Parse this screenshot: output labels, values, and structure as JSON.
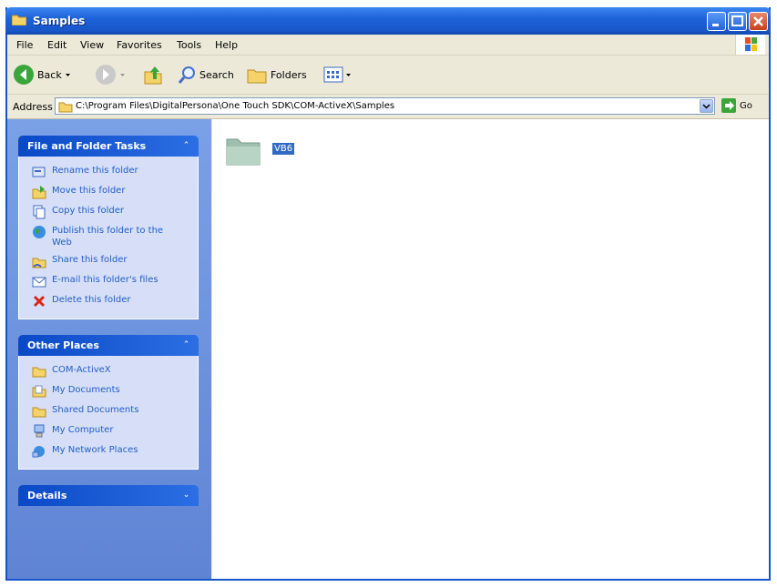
{
  "window": {
    "title": "Samples"
  },
  "menu": {
    "items": [
      "File",
      "Edit",
      "View",
      "Favorites",
      "Tools",
      "Help"
    ]
  },
  "toolbar": {
    "back": "Back",
    "search": "Search",
    "folders": "Folders"
  },
  "address": {
    "label": "Address",
    "path": "C:\\Program Files\\DigitalPersona\\One Touch SDK\\COM-ActiveX\\Samples",
    "go": "Go"
  },
  "file_folder_tasks": {
    "title": "File and Folder Tasks",
    "items": [
      {
        "label": "Rename this folder",
        "icon": "rename-icon"
      },
      {
        "label": "Move this folder",
        "icon": "move-icon"
      },
      {
        "label": "Copy this folder",
        "icon": "copy-icon"
      },
      {
        "label": "Publish this folder to the Web",
        "icon": "globe-icon"
      },
      {
        "label": "Share this folder",
        "icon": "share-icon"
      },
      {
        "label": "E-mail this folder's files",
        "icon": "email-icon"
      },
      {
        "label": "Delete this folder",
        "icon": "delete-icon"
      }
    ]
  },
  "other_places": {
    "title": "Other Places",
    "items": [
      {
        "label": "COM-ActiveX",
        "icon": "folder-icon"
      },
      {
        "label": "My Documents",
        "icon": "documents-icon"
      },
      {
        "label": "Shared Documents",
        "icon": "folder-icon"
      },
      {
        "label": "My Computer",
        "icon": "computer-icon"
      },
      {
        "label": "My Network Places",
        "icon": "network-icon"
      }
    ]
  },
  "details": {
    "title": "Details"
  },
  "content": {
    "items": [
      {
        "label": "VB6",
        "selected": true
      }
    ]
  },
  "colors": {
    "titlebar": "#1f62d9",
    "task_pane": "#6f96e0",
    "panel_body": "#d6dff7",
    "link": "#215dc6",
    "selection": "#316ac5"
  }
}
